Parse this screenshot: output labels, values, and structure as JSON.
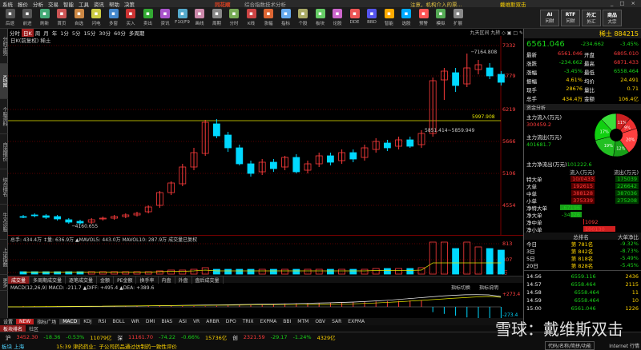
{
  "menubar": {
    "items": [
      "系统",
      "报价",
      "分析",
      "交易",
      "智能",
      "工具",
      "资讯",
      "帮助",
      "决策"
    ],
    "brand": "同花顺",
    "title": "综合指数技术分析",
    "notice": "注意，机构介入的票...",
    "user": "戴维斯双击",
    "winbtns": "_ □ ×"
  },
  "toolbar": {
    "buttons": [
      "后退",
      "前进",
      "刷新",
      "首页",
      "自选",
      "闪电",
      "多窗",
      "买入",
      "卖出",
      "资讯",
      "F10/F9",
      "画线",
      "周期",
      "分时",
      "K线",
      "涨幅",
      "指标",
      "个股",
      "板块",
      "论股",
      "DDE",
      "BBD",
      "智能",
      "选股",
      "预警",
      "模拟",
      "扩展"
    ],
    "right_buttons": [
      {
        "tag": "AI",
        "label": "问财"
      },
      {
        "tag": "RTF",
        "label": "问财"
      },
      {
        "tag": "外汇",
        "label": "外汇"
      },
      {
        "tag": "商品",
        "label": "大宗"
      }
    ]
  },
  "sidebar": [
    "分时走势",
    "K线图",
    "个股资料",
    "自选报价",
    "综合排名",
    "牛叉诊股",
    "上证指数",
    "更多"
  ],
  "periods": {
    "items": [
      "分时",
      "日K",
      "周",
      "月",
      "年",
      "1分",
      "5分",
      "15分",
      "30分",
      "60分",
      "多周期"
    ],
    "active": 1,
    "chart_tools": "九天区间  九转  ◇ ▣ □ ✎"
  },
  "chart": {
    "title": "日K(前复权)  稀土",
    "price_ticks": [
      "7332",
      "6779",
      "6219",
      "5666",
      "5106",
      "4554"
    ],
    "annotations": {
      "high": "7164.808",
      "low": "4160.655",
      "range": "5851.414~5859.949",
      "ref_line": "5997.908"
    },
    "volume_label": "总手: 434.4万  ↕量: 636.9万  ▲MAVOL5: 443.0万  MAVOL10: 287.9万  成交量已复权",
    "vol_ticks": [
      "813",
      "407",
      "万"
    ],
    "macd_label": "MACD(12,26,9)  MACD: -211.7  ▲DIFF: +495.4  ▲DEA: +389.6",
    "macd_ticks": [
      "+273.4",
      "-273.4"
    ],
    "date_labels": [
      "26",
      "27",
      "28",
      "29",
      "30",
      "31",
      "01",
      "02",
      "03",
      "04",
      "05",
      "06",
      "07",
      "08",
      "09",
      "10",
      "11",
      "12",
      "13",
      "14",
      "15",
      "16",
      "17",
      "18",
      "19",
      "20",
      "21",
      "22",
      "23",
      "24",
      "25",
      "26",
      "27",
      "28",
      "29",
      "30",
      "01",
      "02",
      "03",
      "04",
      "05",
      "06",
      "07",
      "08"
    ],
    "indicator_buttons": [
      "指标切换",
      "指标说明"
    ]
  },
  "bottom_tabs": [
    "成交量",
    "多周期成交量",
    "逐笔成交量",
    "金额",
    "PE金额",
    "换手率",
    "内盘",
    "外盘",
    "盘后成交量"
  ],
  "indicator_tabs": [
    "设置",
    "NEW",
    "指标广场",
    "MACD",
    "KDJ",
    "RSI",
    "BOLL",
    "WR",
    "DMI",
    "BIAS",
    "ASI",
    "VR",
    "ARBR",
    "DPO",
    "TRIX",
    "EXPMA",
    "BBI",
    "MTM",
    "OBV",
    "SAR",
    "EXPMA"
  ],
  "mini_tabs": [
    "板块排名",
    "社区"
  ],
  "quote": {
    "name": "稀土",
    "code": "884215",
    "price": "6561.046",
    "change": "-234.662",
    "pct": "-3.45%",
    "rows": [
      {
        "l1": "最新",
        "v1": "6561.046",
        "c1": "red",
        "l2": "开盘",
        "v2": "6805.010",
        "c2": "red"
      },
      {
        "l1": "涨跌",
        "v1": "-234.662",
        "c1": "green",
        "l2": "最高",
        "v2": "6871.433",
        "c2": "red"
      },
      {
        "l1": "涨幅",
        "v1": "-3.45%",
        "c1": "green",
        "l2": "最低",
        "v2": "6558.464",
        "c2": "green"
      },
      {
        "l1": "振幅",
        "v1": "4.61%",
        "c1": "yellow",
        "l2": "均价",
        "v2": "24.491",
        "c2": "yellow"
      },
      {
        "l1": "现手",
        "v1": "28676",
        "c1": "yellow",
        "l2": "量比",
        "v2": "0.71",
        "c2": "yellow"
      },
      {
        "l1": "总手",
        "v1": "434.4万",
        "c1": "yellow",
        "l2": "金额",
        "v2": "106.4亿",
        "c2": "yellow"
      }
    ]
  },
  "fund_flow": {
    "title": "资金分析",
    "inflow_label": "主力流入(万元)",
    "inflow": "300459.2",
    "outflow_label": "主力流出(万元)",
    "outflow": "401681.7",
    "net_label": "主力净流出(万元)",
    "net": "101222.6",
    "pie": [
      {
        "label": "11%",
        "color": "#cc2020",
        "value": 11
      },
      {
        "label": "9%",
        "color": "#ee3030",
        "value": 9
      },
      {
        "label": "20%",
        "color": "#ff4040",
        "value": 20
      },
      {
        "label": "12%",
        "color": "#18a018",
        "value": 12
      },
      {
        "label": "19%",
        "color": "#22c022",
        "value": 19
      },
      {
        "label": "17%",
        "color": "#10d010",
        "value": 17
      },
      {
        "label": "",
        "color": "#3ae03a",
        "value": 12
      }
    ],
    "headers": [
      "流入(万元)",
      "流出(万元)"
    ],
    "rows": [
      {
        "label": "特大单",
        "in": "10/0433",
        "out": "175039"
      },
      {
        "label": "大单",
        "in": "192615",
        "out": "226642"
      },
      {
        "label": "中单",
        "in": "388128",
        "out": "387036"
      },
      {
        "label": "小单",
        "in": "375339",
        "out": "275208"
      }
    ],
    "net_rows": [
      {
        "label": "净特大单",
        "value": "-67196",
        "dir": "neg",
        "frac": 0.67
      },
      {
        "label": "净大单",
        "value": "-34026",
        "dir": "neg",
        "frac": 0.34
      },
      {
        "label": "净中单",
        "value": "1092",
        "dir": "pos",
        "frac": 0.02
      },
      {
        "label": "净小单",
        "value": "100130",
        "dir": "pos",
        "frac": 1.0
      }
    ]
  },
  "ranking": {
    "headers": [
      "",
      "总排名",
      "大单净比"
    ],
    "rows": [
      {
        "period": "今日",
        "rank": "第 781名",
        "ratio": "-9.32%"
      },
      {
        "period": "3日",
        "rank": "第 842名",
        "ratio": "-8.73%"
      },
      {
        "period": "5日",
        "rank": "第 818名",
        "ratio": "-5.49%"
      },
      {
        "period": "20日",
        "rank": "第 828名",
        "ratio": "-5.45%"
      }
    ]
  },
  "ticks": [
    {
      "time": "14:56",
      "price": "6559.116",
      "vol": "2436"
    },
    {
      "time": "14:57",
      "price": "6558.464",
      "vol": "2115"
    },
    {
      "time": "14:58",
      "price": "6558.464",
      "vol": "11"
    },
    {
      "time": "14:59",
      "price": "6558.464",
      "vol": "10"
    },
    {
      "time": "15:00",
      "price": "6561.046",
      "vol": "1226"
    }
  ],
  "statusbar": {
    "line1": [
      {
        "t": "沪",
        "c": "white"
      },
      {
        "t": "3452.30",
        "c": "red"
      },
      {
        "t": "-18.36",
        "c": "green"
      },
      {
        "t": "-0.53%",
        "c": "green"
      },
      {
        "t": "11079亿",
        "c": "yellow"
      },
      {
        "t": "深",
        "c": "white"
      },
      {
        "t": "11161.70",
        "c": "red"
      },
      {
        "t": "-74.22",
        "c": "green"
      },
      {
        "t": "-0.66%",
        "c": "green"
      },
      {
        "t": "15736亿",
        "c": "yellow"
      },
      {
        "t": "创",
        "c": "white"
      },
      {
        "t": "2321.59",
        "c": "red"
      },
      {
        "t": "-29.17",
        "c": "green"
      },
      {
        "t": "-1.24%",
        "c": "green"
      },
      {
        "t": "4329亿",
        "c": "yellow"
      }
    ],
    "line2": "15:39 津药药业：子公司药品通过仿制药一致性评价",
    "line2_left": "板块 上海",
    "right_info": "代码/名称/简拼/功能",
    "internet": "Internet  行情"
  },
  "watermark": "雪球：戴维斯双击"
}
